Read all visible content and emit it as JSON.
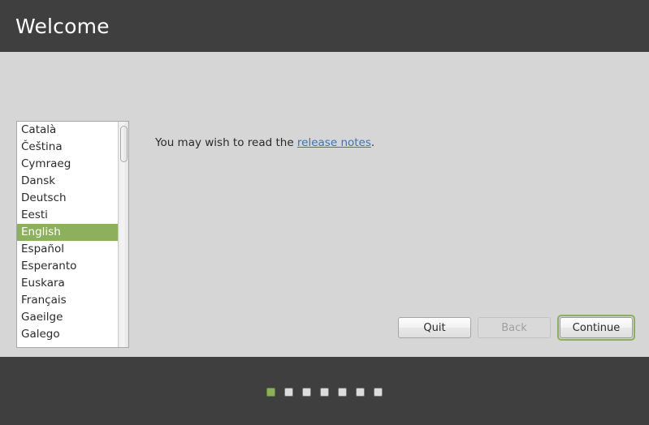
{
  "header": {
    "title": "Welcome"
  },
  "language_list": {
    "selected": "English",
    "items": [
      {
        "label": "Català",
        "selected": false
      },
      {
        "label": "Čeština",
        "selected": false
      },
      {
        "label": "Cymraeg",
        "selected": false
      },
      {
        "label": "Dansk",
        "selected": false
      },
      {
        "label": "Deutsch",
        "selected": false
      },
      {
        "label": "Eesti",
        "selected": false
      },
      {
        "label": "English",
        "selected": true
      },
      {
        "label": "Español",
        "selected": false
      },
      {
        "label": "Esperanto",
        "selected": false
      },
      {
        "label": "Euskara",
        "selected": false
      },
      {
        "label": "Français",
        "selected": false
      },
      {
        "label": "Gaeilge",
        "selected": false
      },
      {
        "label": "Galego",
        "selected": false
      }
    ]
  },
  "main": {
    "notes_prefix": "You may wish to read the ",
    "notes_link": "release notes",
    "notes_suffix": "."
  },
  "buttons": {
    "quit": "Quit",
    "back": "Back",
    "continue": "Continue"
  },
  "footer": {
    "steps_total": 7,
    "steps_active_index": 0
  },
  "colors": {
    "chrome_dark": "#3f3f3f",
    "page_background": "#d6d6d6",
    "accent_green": "#8cb05c",
    "link_blue": "#3f72b5"
  }
}
